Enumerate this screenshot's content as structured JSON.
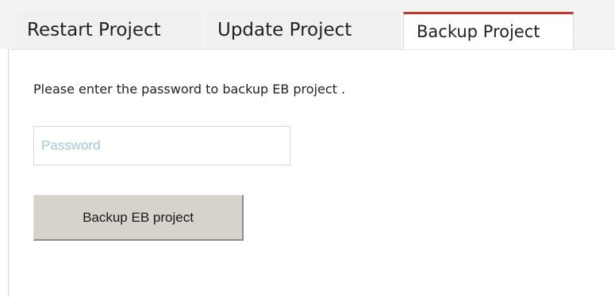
{
  "tabs": [
    {
      "label": "Restart Project",
      "active": false
    },
    {
      "label": "Update Project",
      "active": false
    },
    {
      "label": "Backup Project",
      "active": true
    }
  ],
  "backup_panel": {
    "instruction": "Please enter the password to backup EB project .",
    "password": {
      "placeholder": "Password",
      "value": ""
    },
    "submit_label": "Backup EB project"
  },
  "colors": {
    "active_tab_accent": "#c0392b",
    "placeholder_text": "#9fc7e0",
    "button_face": "#d6d2cc"
  }
}
